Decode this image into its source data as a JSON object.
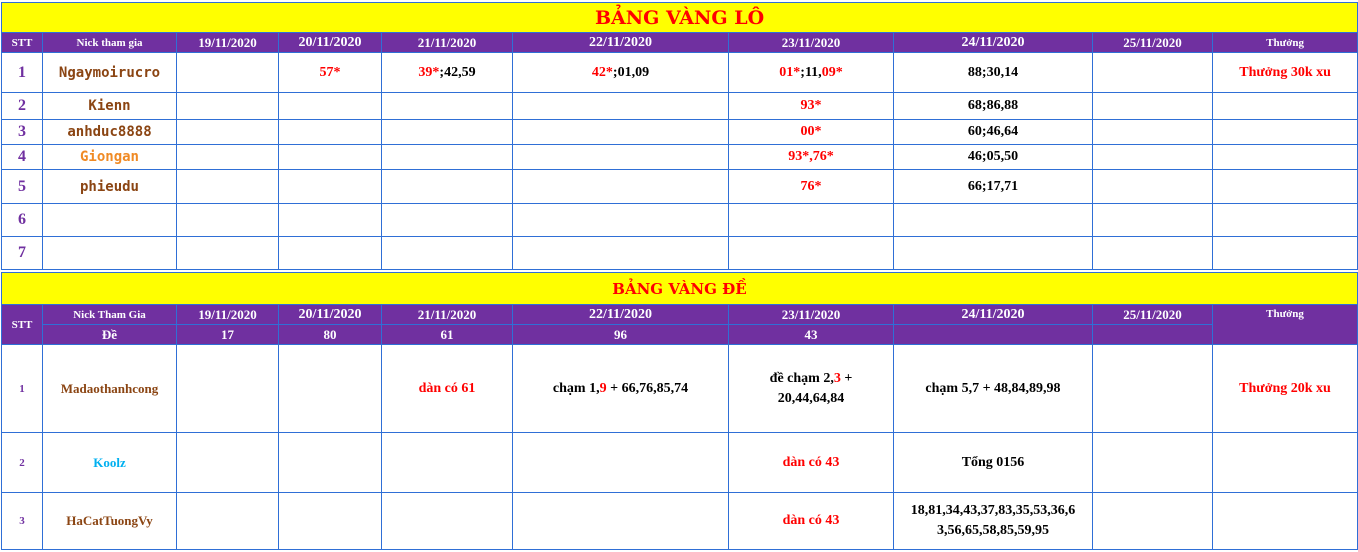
{
  "colors": {
    "title_bg": "#ffff00",
    "title_text": "#ff0000",
    "header_bg": "#7030a0",
    "header_text": "#ffffff",
    "grid": "#2f6fd6",
    "highlight": "#ff0000"
  },
  "lo": {
    "title": "BẢNG VÀNG LÔ",
    "headers": {
      "stt": "STT",
      "nick": "Nick tham gia",
      "reward": "Thưởng"
    },
    "dates": [
      "19/11/2020",
      "20/11/2020",
      "21/11/2020",
      "22/11/2020",
      "23/11/2020",
      "24/11/2020",
      "25/11/2020"
    ],
    "rows": [
      {
        "stt": "1",
        "nick": "Ngaymoirucro",
        "d20_red": "57*",
        "d21_red": "39*",
        "d21_rest": ";42,59",
        "d22_red": "42*",
        "d22_rest": ";01,09",
        "d23_a": "01*",
        "d23_b": ";11,",
        "d23_c": "09*",
        "d24": "88;30,14",
        "reward": "Thưởng 30k xu"
      },
      {
        "stt": "2",
        "nick": "Kienn",
        "d23": "93*",
        "d24": "68;86,88"
      },
      {
        "stt": "3",
        "nick": "anhduc8888",
        "d23": "00*",
        "d24": "60;46,64"
      },
      {
        "stt": "4",
        "nick": "Giongan",
        "d23": "93*,76*",
        "d24": "46;05,50"
      },
      {
        "stt": "5",
        "nick": "phieudu",
        "d23": "76*",
        "d24": "66;17,71"
      },
      {
        "stt": "6"
      },
      {
        "stt": "7"
      }
    ]
  },
  "de": {
    "title": "BẢNG VÀNG ĐỀ",
    "headers": {
      "stt": "STT",
      "nick": "Nick Tham Gia",
      "de_label": "Đề",
      "reward": "Thưởng"
    },
    "dates": [
      "19/11/2020",
      "20/11/2020",
      "21/11/2020",
      "22/11/2020",
      "23/11/2020",
      "24/11/2020",
      "25/11/2020"
    ],
    "results": [
      "17",
      "80",
      "61",
      "96",
      "43",
      "",
      ""
    ],
    "rows": [
      {
        "stt": "1",
        "nick": "Madaothanhcong",
        "d21": "dàn có 61",
        "d22_a": "chạm 1,",
        "d22_b": "9",
        "d22_c": " + 66,76,85,74",
        "d23_a": "đề chạm 2,",
        "d23_b": "3",
        "d23_c": " +",
        "d23_d": "20,44,64,84",
        "d24": "chạm 5,7 + 48,84,89,98",
        "reward": "Thưởng 20k xu"
      },
      {
        "stt": "2",
        "nick": "Koolz",
        "d23": "dàn có 43",
        "d24": "Tổng 0156"
      },
      {
        "stt": "3",
        "nick": "HaCatTuongVy",
        "d23": "dàn có 43",
        "d24_line1": "18,81,34,43,37,83,35,53,36,6",
        "d24_line2": "3,56,65,58,85,59,95"
      }
    ]
  }
}
